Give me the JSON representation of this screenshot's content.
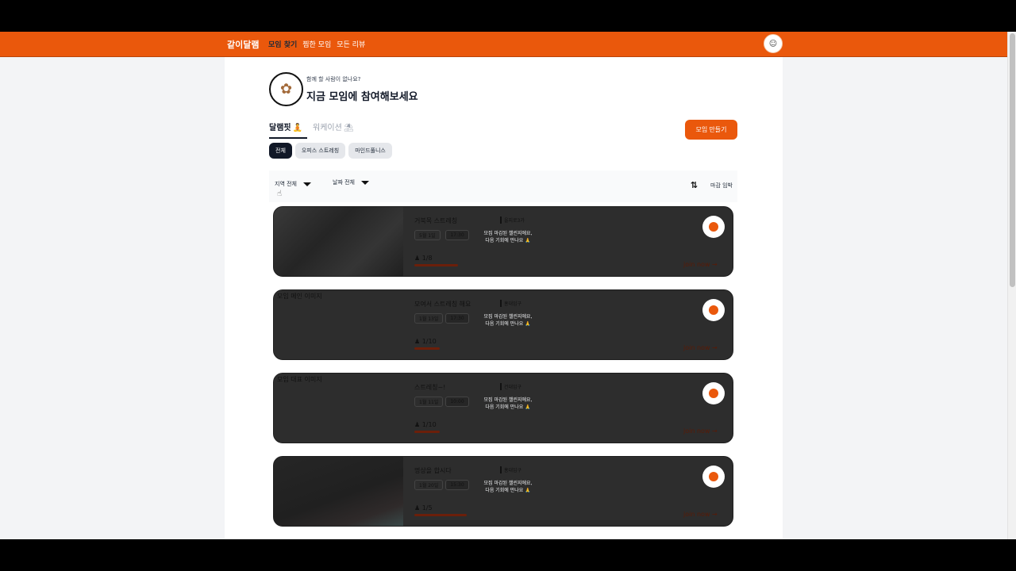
{
  "nav": {
    "logo": "같이달램",
    "items": [
      {
        "label": "모임 찾기",
        "active": true
      },
      {
        "label": "찜한 모임",
        "active": false
      },
      {
        "label": "모든 리뷰",
        "active": false
      }
    ]
  },
  "hero": {
    "subtitle": "함께 할 사람이 없나요?",
    "title": "지금 모임에 참여해보세요"
  },
  "tabs": {
    "dallaemfit": "달램핏",
    "workation": "워케이션"
  },
  "create_button": "모임 만들기",
  "chips": [
    "전체",
    "오피스 스트레칭",
    "마인드풀니스"
  ],
  "filters": {
    "region": "지역 전체",
    "date": "날짜 전체",
    "sort": "마감 임박"
  },
  "cards": [
    {
      "title": "거북목 스트레칭",
      "location": "을지로3가",
      "date": "5월 1일",
      "time": "17:30",
      "closed_line1": "모집 마감된 챌린지에요,",
      "closed_line2": "다음 기회에 만나요 🙏",
      "count": "1/8",
      "join": "join now →",
      "progress": 0.125,
      "thumb_alt": ""
    },
    {
      "title": "모여서 스트레칭 해요",
      "location": "홍대입구",
      "date": "1월 13일",
      "time": "17:30",
      "closed_line1": "모집 마감된 챌린지에요,",
      "closed_line2": "다음 기회에 만나요 🙏",
      "count": "1/10",
      "join": "join now →",
      "progress": 0.1,
      "thumb_alt": "모임 메인 이미지"
    },
    {
      "title": "스트레칭~!",
      "location": "건대입구",
      "date": "1월 11일",
      "time": "10:00",
      "closed_line1": "모집 마감된 챌린지에요,",
      "closed_line2": "다음 기회에 만나요 🙏",
      "count": "1/10",
      "join": "join now →",
      "progress": 0.1,
      "thumb_alt": "모임 대표 이미지"
    },
    {
      "title": "명상을 합시다",
      "location": "홍대입구",
      "date": "1월 20일",
      "time": "15:30",
      "closed_line1": "모집 마감된 챌린지에요,",
      "closed_line2": "다음 기회에 만나요 🙏",
      "count": "1/5",
      "join": "join now →",
      "progress": 0.2,
      "thumb_alt": ""
    }
  ]
}
